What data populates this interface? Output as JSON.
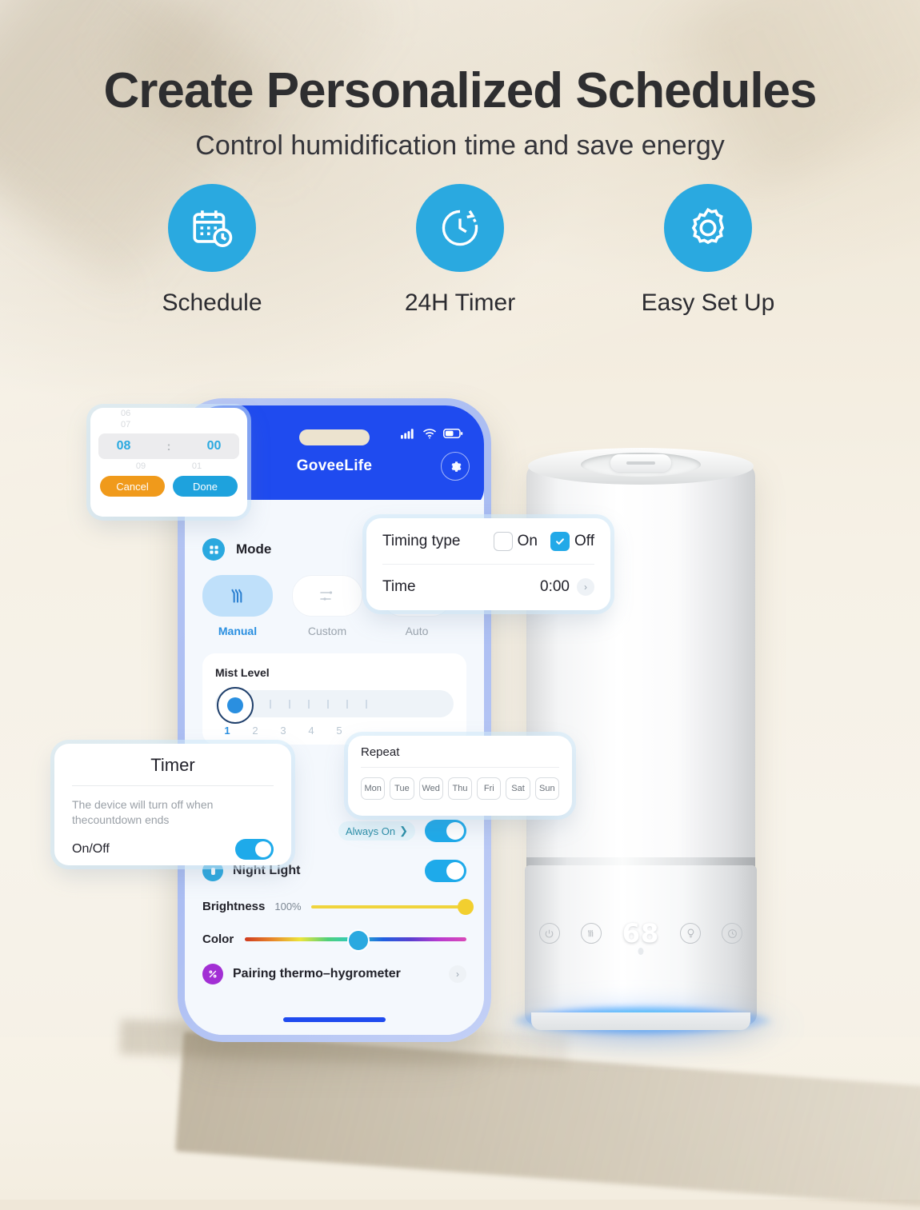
{
  "header": {
    "headline": "Create Personalized Schedules",
    "subhead": "Control humidification time and save energy"
  },
  "features": [
    {
      "icon": "calendar-clock-icon",
      "label": "Schedule"
    },
    {
      "icon": "clock-arrow-icon",
      "label": "24H Timer"
    },
    {
      "icon": "gear-icon",
      "label": "Easy Set Up"
    }
  ],
  "phone": {
    "brand": "GoveeLife",
    "status": {
      "signal": "signal-icon",
      "wifi": "wifi-icon",
      "battery": "battery-icon"
    },
    "settings_icon": "gear-icon",
    "mode": {
      "label": "Mode",
      "icon": "grid-dots-icon",
      "tabs": [
        {
          "label": "Manual",
          "icon": "mist-waves-icon",
          "active": "true"
        },
        {
          "label": "Custom",
          "icon": "sliders-icon",
          "active": "false"
        },
        {
          "label": "Auto",
          "icon": "",
          "active": "false"
        }
      ]
    },
    "mist": {
      "title": "Mist Level",
      "levels": [
        "1",
        "2",
        "3",
        "4",
        "5"
      ],
      "selected": "1"
    },
    "always_on": {
      "label": "Always On",
      "chevron": "chevron-right-icon"
    },
    "night_light": {
      "label": "Night Light",
      "icon": "night-light-icon"
    },
    "brightness": {
      "label": "Brightness",
      "value": "100%"
    },
    "color": {
      "label": "Color"
    },
    "pairing": {
      "label": "Pairing thermo–hygrometer",
      "icon": "thermo-hygrometer-icon"
    }
  },
  "time_picker": {
    "ghost_above_hour": "06",
    "ghost_above_hour2": "07",
    "hour": "08",
    "colon": ":",
    "minute": "00",
    "ghost_below_hour": "09",
    "ghost_below_minute": "01",
    "cancel_label": "Cancel",
    "done_label": "Done"
  },
  "timing_type": {
    "label": "Timing type",
    "on_label": "On",
    "off_label": "Off",
    "on_checked": "false",
    "off_checked": "true",
    "time_label": "Time",
    "time_value": "0:00",
    "chevron": "chevron-right-icon"
  },
  "timer_card": {
    "title": "Timer",
    "description": "The device will turn off when thecountdown ends",
    "toggle_label": "On/Off",
    "toggle_state": "on"
  },
  "repeat_card": {
    "title": "Repeat",
    "days": [
      "Mon",
      "Tue",
      "Wed",
      "Thu",
      "Fri",
      "Sat",
      "Sun"
    ]
  },
  "device": {
    "display_value": "68",
    "panel_icons": [
      "power-icon",
      "mist-icon",
      "light-icon",
      "timer-icon"
    ]
  },
  "colors": {
    "accent_blue": "#2aa9e0",
    "header_blue": "#1f4bef",
    "orange": "#f09a1b",
    "background": "#f2ebdd",
    "glow_cyan": "#3cd2f5"
  }
}
